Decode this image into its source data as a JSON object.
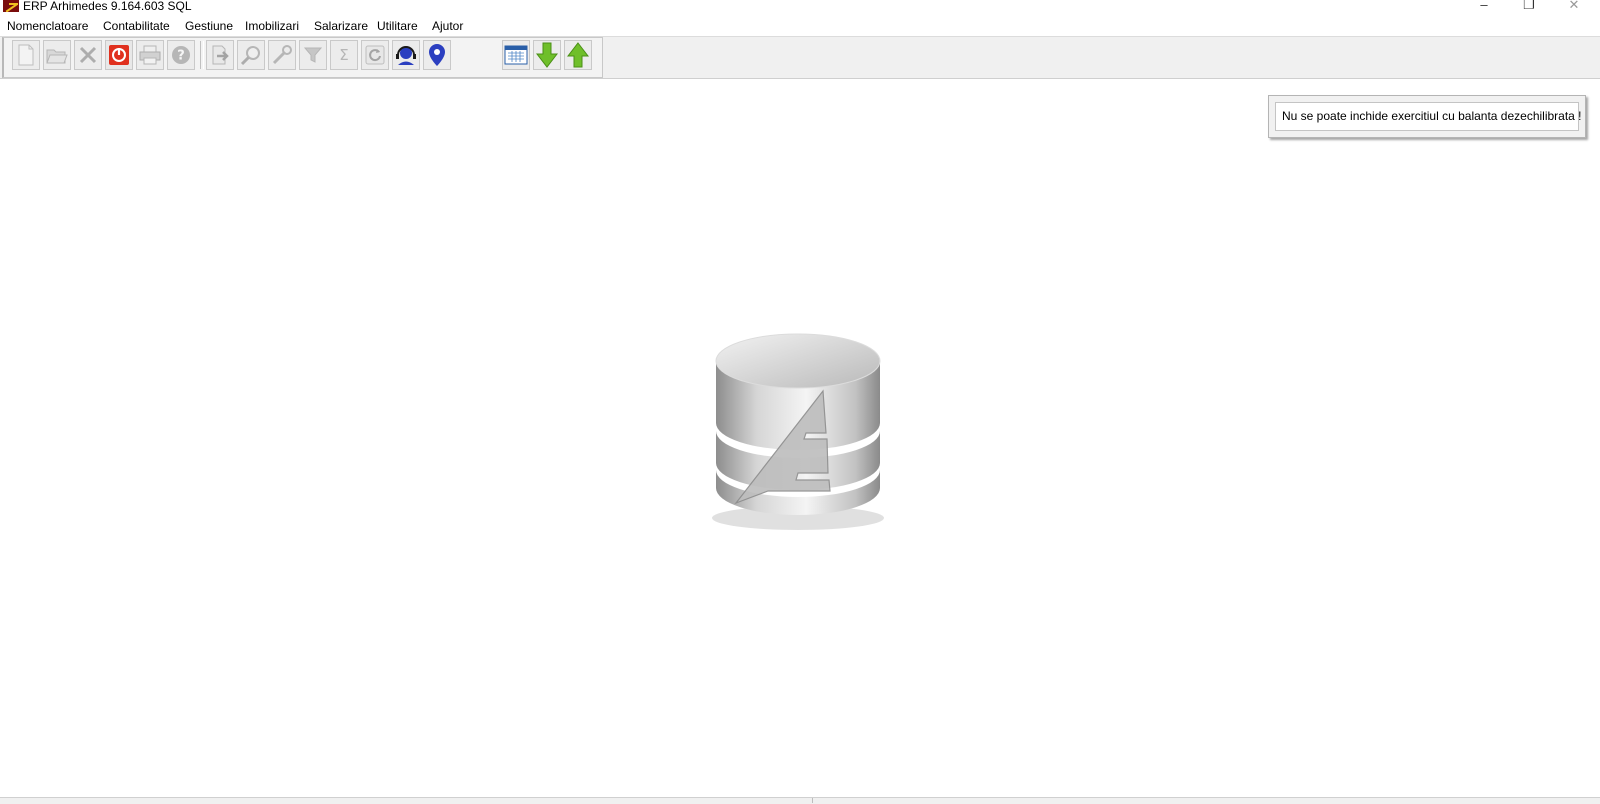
{
  "window": {
    "title": "ERP Arhimedes 9.164.603 SQL",
    "minimize_icon": "minimize-icon",
    "restore_icon": "restore-icon",
    "close_icon": "close-icon"
  },
  "menu": {
    "items": [
      "Nomenclatoare",
      "Contabilitate",
      "Gestiune",
      "Imobilizari",
      "Salarizare",
      "Utilitare",
      "Ajutor"
    ]
  },
  "toolbar": {
    "buttons": [
      {
        "icon": "new-document-icon",
        "enabled": false
      },
      {
        "icon": "open-folder-icon",
        "enabled": false
      },
      {
        "icon": "delete-icon",
        "enabled": false
      },
      {
        "icon": "power-icon",
        "enabled": true
      },
      {
        "icon": "print-icon",
        "enabled": false
      },
      {
        "icon": "help-icon",
        "enabled": false
      },
      {
        "icon": "export-icon",
        "enabled": false
      },
      {
        "icon": "search-icon",
        "enabled": false
      },
      {
        "icon": "tools-icon",
        "enabled": false
      },
      {
        "icon": "filter-icon",
        "enabled": false
      },
      {
        "icon": "sum-icon",
        "enabled": false
      },
      {
        "icon": "refresh-icon",
        "enabled": false
      },
      {
        "icon": "support-headset-icon",
        "enabled": true
      },
      {
        "icon": "location-pin-icon",
        "enabled": true
      },
      {
        "icon": "calendar-icon",
        "enabled": true
      },
      {
        "icon": "arrow-down-icon",
        "enabled": true
      },
      {
        "icon": "arrow-up-icon",
        "enabled": true
      }
    ]
  },
  "notification": {
    "message": "Nu se poate inchide exercitiul cu balanta dezechilibrata !"
  },
  "center": {
    "icon": "database-logo-icon"
  },
  "colors": {
    "toolbar_bg": "#f0f0f0",
    "power_red": "#e0301e",
    "pin_blue": "#2b3fc0",
    "arrow_green": "#6fbf2a",
    "logo_red": "#7a0c0c"
  }
}
